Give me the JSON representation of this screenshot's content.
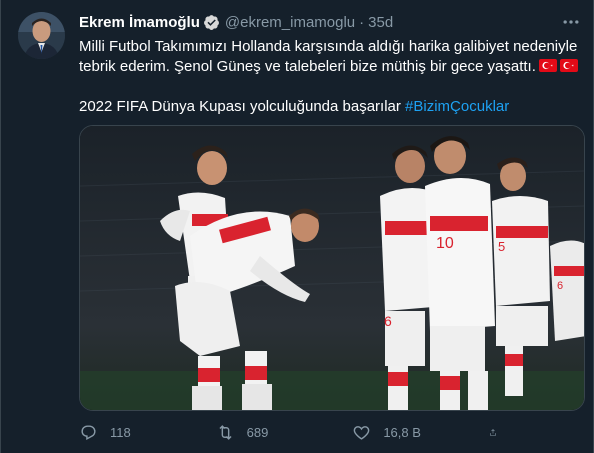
{
  "user": {
    "display_name": "Ekrem İmamoğlu",
    "handle": "@ekrem_imamoglu",
    "separator": "·",
    "time": "35d",
    "verified": true
  },
  "tweet": {
    "line1": "Milli Futbol Takımımızı Hollanda karşısında aldığı harika galibiyet nedeniyle",
    "line2": "tebrik ederim. Şenol Güneş ve talebeleri bize müthiş bir gece yaşattı.",
    "line3": "2022 FIFA Dünya Kupası yolculuğunda başarılar",
    "hashtag": "#BizimÇocuklar"
  },
  "media": {
    "description": "Turkey national football players celebrating on the pitch",
    "jersey_numbers": [
      "6",
      "10",
      "5",
      "6"
    ]
  },
  "actions": {
    "reply_count": "118",
    "retweet_count": "689",
    "like_count": "16,8 B"
  },
  "colors": {
    "background": "#15202b",
    "accent": "#1da1f2",
    "muted": "#8899a6",
    "flag_red": "#e30a17"
  },
  "icons": [
    "verified-icon",
    "more-icon",
    "flag-tr-icon",
    "reply-icon",
    "retweet-icon",
    "like-icon",
    "share-icon"
  ]
}
